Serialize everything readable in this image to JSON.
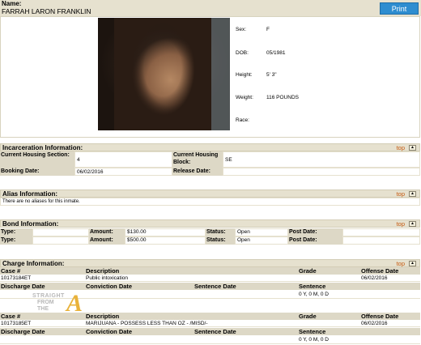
{
  "header": {
    "name_label": "Name:",
    "name_value": "FARRAH LARON FRANKLIN",
    "print_label": "Print"
  },
  "profile": {
    "sex_label": "Sex:",
    "sex_value": "F",
    "dob_label": "DOB:",
    "dob_value": "05/1981",
    "height_label": "Height:",
    "height_value": "5' 3\"",
    "weight_label": "Weight:",
    "weight_value": "116 POUNDS",
    "race_label": "Race:",
    "race_value": ""
  },
  "top_link": "top",
  "incarceration": {
    "title": "Incarceration Information:",
    "housing_section_label": "Current Housing Section:",
    "housing_section_value": "4",
    "housing_block_label": "Current Housing Block:",
    "housing_block_value": "SE",
    "booking_date_label": "Booking Date:",
    "booking_date_value": "06/02/2016",
    "release_date_label": "Release Date:",
    "release_date_value": ""
  },
  "alias": {
    "title": "Alias Information:",
    "text": "There are no aliases for this inmate."
  },
  "bond": {
    "title": "Bond Information:",
    "rows": [
      {
        "type_label": "Type:",
        "type_value": "",
        "amount_label": "Amount:",
        "amount_value": "$130.00",
        "status_label": "Status:",
        "status_value": "Open",
        "post_label": "Post Date:",
        "post_value": ""
      },
      {
        "type_label": "Type:",
        "type_value": "",
        "amount_label": "Amount:",
        "amount_value": "$500.00",
        "status_label": "Status:",
        "status_value": "Open",
        "post_label": "Post Date:",
        "post_value": ""
      }
    ]
  },
  "charge": {
    "title": "Charge Information:",
    "h_case": "Case #",
    "h_desc": "Description",
    "h_grade": "Grade",
    "h_offense": "Offense Date",
    "h_discharge": "Discharge Date",
    "h_conviction": "Conviction Date",
    "h_sentence_date": "Sentence Date",
    "h_sentence": "Sentence",
    "items": [
      {
        "case": "10173184ET",
        "desc": "Public intoxication",
        "grade": "",
        "offense": "06/02/2016",
        "discharge": "",
        "conviction": "",
        "sentence_date": "",
        "sentence": "0 Y, 0 M, 0 D"
      },
      {
        "case": "10173185ET",
        "desc": "MARIJUANA - POSSESS LESS THAN OZ - /MISD/-",
        "grade": "",
        "offense": "06/02/2016",
        "discharge": "",
        "conviction": "",
        "sentence_date": "",
        "sentence": "0 Y, 0 M, 0 D"
      }
    ]
  },
  "watermark": {
    "line1": "STRAIGHT",
    "line2": "FROM",
    "line3": "THE",
    "letter": "A"
  }
}
